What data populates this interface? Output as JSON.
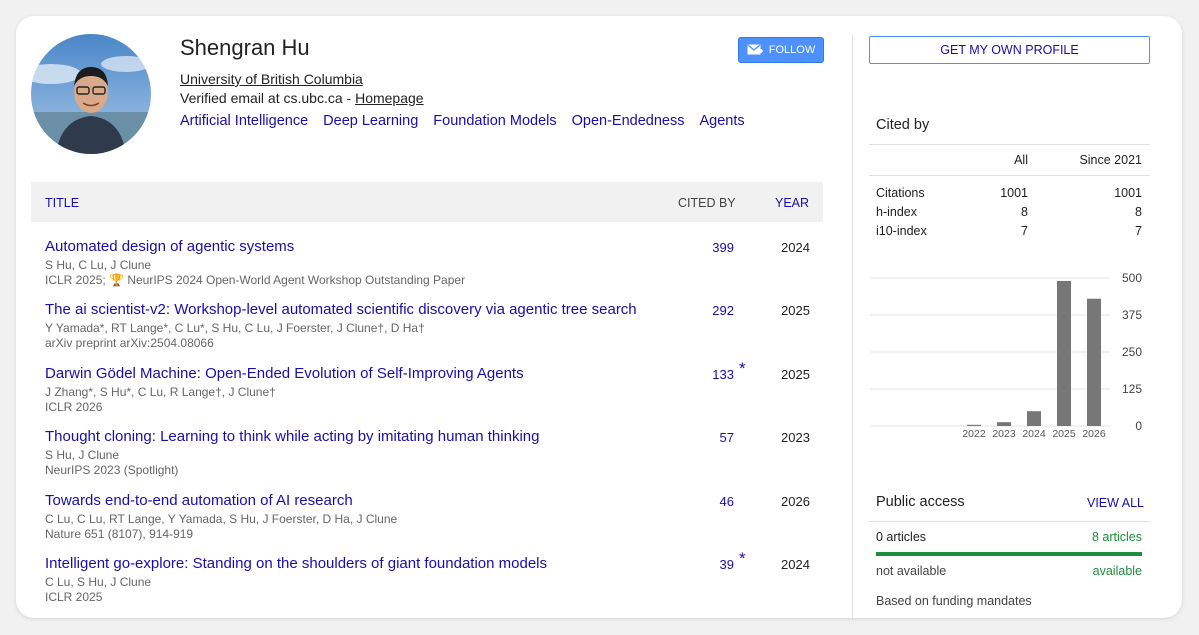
{
  "profile": {
    "name": "Shengran Hu",
    "affiliation": "University of British Columbia",
    "email_text": "Verified email at cs.ubc.ca - ",
    "homepage_label": "Homepage",
    "interests": [
      "Artificial Intelligence",
      "Deep Learning",
      "Foundation Models",
      "Open-Endedness",
      "Agents"
    ],
    "follow_label": "FOLLOW"
  },
  "table": {
    "col_title": "TITLE",
    "col_cited": "CITED BY",
    "col_year": "YEAR",
    "rows": [
      {
        "title": "Automated design of agentic systems",
        "authors": "S Hu, C Lu, J Clune",
        "venue": "ICLR 2025; 🏆 NeurIPS 2024 Open-World Agent Workshop Outstanding Paper",
        "cited": "399",
        "star": "",
        "year": "2024"
      },
      {
        "title": "The ai scientist-v2: Workshop-level automated scientific discovery via agentic tree search",
        "authors": "Y Yamada*, RT Lange*, C Lu*, S Hu, C Lu, J Foerster, J Clune†, D Ha†",
        "venue": "arXiv preprint arXiv:2504.08066",
        "cited": "292",
        "star": "",
        "year": "2025"
      },
      {
        "title": "Darwin Gödel Machine: Open-Ended Evolution of Self-Improving Agents",
        "authors": "J Zhang*, S Hu*, C Lu, R Lange†, J Clune†",
        "venue": "ICLR 2026",
        "cited": "133",
        "star": "*",
        "year": "2025"
      },
      {
        "title": "Thought cloning: Learning to think while acting by imitating human thinking",
        "authors": "S Hu, J Clune",
        "venue": "NeurIPS 2023 (Spotlight)",
        "cited": "57",
        "star": "",
        "year": "2023"
      },
      {
        "title": "Towards end-to-end automation of AI research",
        "authors": "C Lu, C Lu, RT Lange, Y Yamada, S Hu, J Foerster, D Ha, J Clune",
        "venue": "Nature 651 (8107), 914-919",
        "cited": "46",
        "star": "",
        "year": "2026"
      },
      {
        "title": "Intelligent go-explore: Standing on the shoulders of giant foundation models",
        "authors": "C Lu, S Hu, J Clune",
        "venue": "ICLR 2025",
        "cited": "39",
        "star": "*",
        "year": "2024"
      }
    ]
  },
  "sidebar": {
    "own_profile_label": "GET MY OWN PROFILE",
    "cited_by_heading": "Cited by",
    "col_all": "All",
    "col_since": "Since 2021",
    "stats": [
      {
        "label": "Citations",
        "all": "1001",
        "since": "1001"
      },
      {
        "label": "h-index",
        "all": "8",
        "since": "8"
      },
      {
        "label": "i10-index",
        "all": "7",
        "since": "7"
      }
    ],
    "public_access_heading": "Public access",
    "view_all_label": "VIEW ALL",
    "not_available_count": "0 articles",
    "available_count": "8 articles",
    "not_available_label": "not available",
    "available_label": "available",
    "mandates_note": "Based on funding mandates"
  },
  "chart_data": {
    "type": "bar",
    "categories": [
      "2022",
      "2023",
      "2024",
      "2025",
      "2026"
    ],
    "values": [
      4,
      13,
      50,
      490,
      430
    ],
    "ylim": [
      0,
      500
    ],
    "yticks": [
      "500",
      "375",
      "250",
      "125",
      "0"
    ],
    "bar_color": "#777777",
    "grid": true
  }
}
